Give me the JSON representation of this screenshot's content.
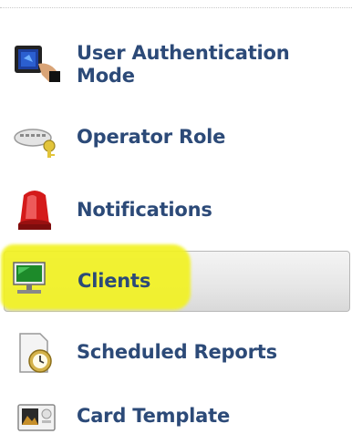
{
  "menu": {
    "items": [
      {
        "label": "User Authentication Mode",
        "icon": "biometric-terminal-icon"
      },
      {
        "label": "Operator Role",
        "icon": "keyboard-key-icon"
      },
      {
        "label": "Notifications",
        "icon": "siren-alarm-icon"
      },
      {
        "label": "Clients",
        "icon": "monitor-icon",
        "selected": true
      },
      {
        "label": "Scheduled Reports",
        "icon": "clock-report-icon"
      },
      {
        "label": "Card Template",
        "icon": "id-card-icon"
      }
    ],
    "selected_item": "Clients"
  },
  "colors": {
    "label_text": "#2c4a78",
    "selection_background": "#e6e6e6",
    "highlight_marker": "#f2f222"
  }
}
